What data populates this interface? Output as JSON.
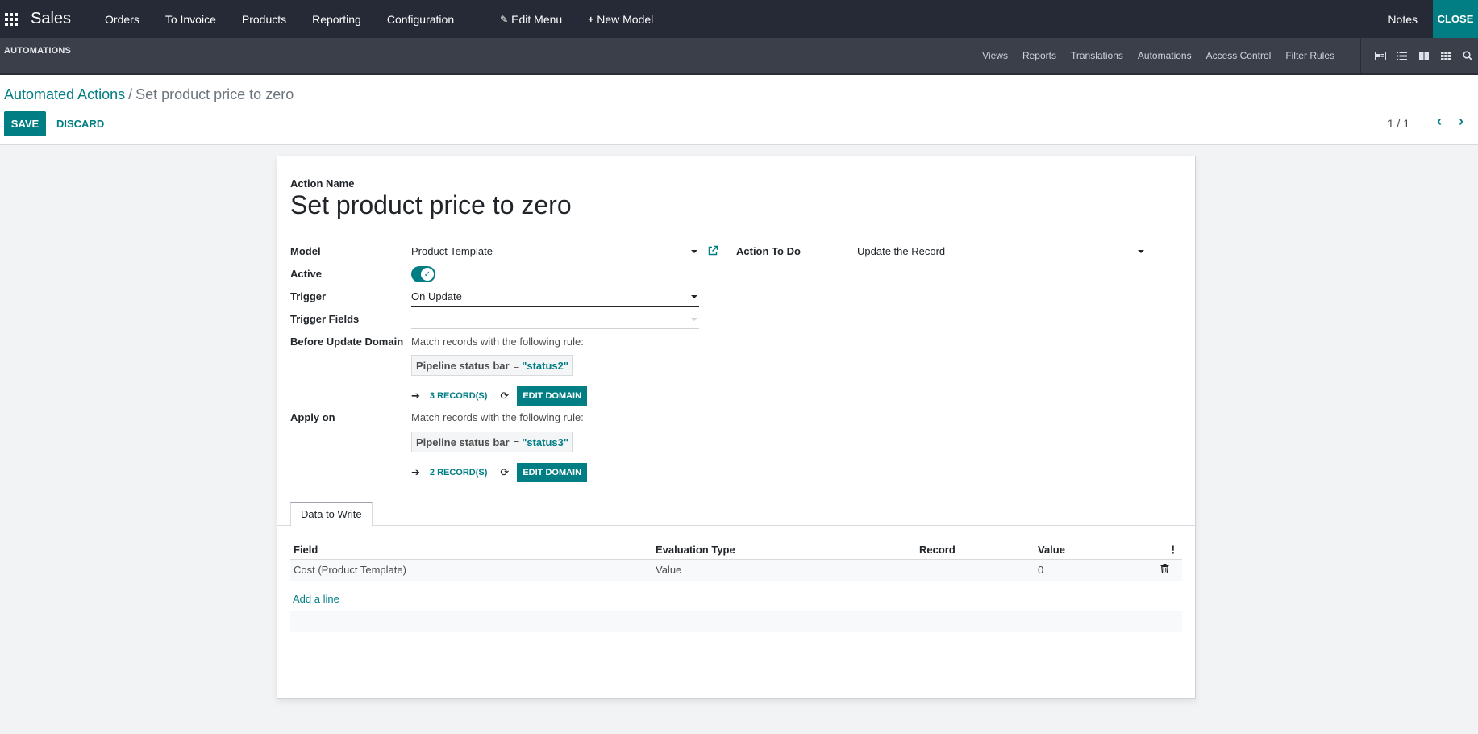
{
  "topbar": {
    "brand": "Sales",
    "menu": [
      "Orders",
      "To Invoice",
      "Products",
      "Reporting",
      "Configuration"
    ],
    "edit_menu": "Edit Menu",
    "new_model": "New Model",
    "notes": "Notes",
    "close": "CLOSE"
  },
  "studio": {
    "title": "AUTOMATIONS",
    "tabs": [
      "Views",
      "Reports",
      "Translations",
      "Automations",
      "Access Control",
      "Filter Rules"
    ],
    "view_icons": [
      "form-view-icon",
      "list-view-icon",
      "kanban-view-icon",
      "grid-view-icon",
      "search-icon"
    ]
  },
  "control": {
    "breadcrumb_parent": "Automated Actions",
    "breadcrumb_sep": "/",
    "breadcrumb_current": "Set product price to zero",
    "save": "SAVE",
    "discard": "DISCARD",
    "pager": "1 / 1"
  },
  "form": {
    "action_name_label": "Action Name",
    "action_name": "Set product price to zero",
    "model_label": "Model",
    "model": "Product Template",
    "action_to_do_label": "Action To Do",
    "action_to_do": "Update the Record",
    "active_label": "Active",
    "active": true,
    "trigger_label": "Trigger",
    "trigger": "On Update",
    "trigger_fields_label": "Trigger Fields",
    "trigger_fields": "",
    "before_domain_label": "Before Update Domain",
    "before_rule_text": "Match records with the following rule:",
    "before_field": "Pipeline status bar",
    "before_op": "=",
    "before_value": "\"status2\"",
    "before_records": "3 RECORD(S)",
    "before_edit": "EDIT DOMAIN",
    "apply_label": "Apply on",
    "apply_rule_text": "Match records with the following rule:",
    "apply_field": "Pipeline status bar",
    "apply_op": "=",
    "apply_value": "\"status3\"",
    "apply_records": "2 RECORD(S)",
    "apply_edit": "EDIT DOMAIN"
  },
  "notebook": {
    "tab": "Data to Write",
    "columns": [
      "Field",
      "Evaluation Type",
      "Record",
      "Value"
    ],
    "rows": [
      {
        "field": "Cost (Product Template)",
        "evaluation_type": "Value",
        "record": "",
        "value": "0"
      }
    ],
    "add_line": "Add a line"
  },
  "colors": {
    "accent": "#017e84",
    "navbar": "#262a36",
    "subbar": "#3b3f4a"
  }
}
